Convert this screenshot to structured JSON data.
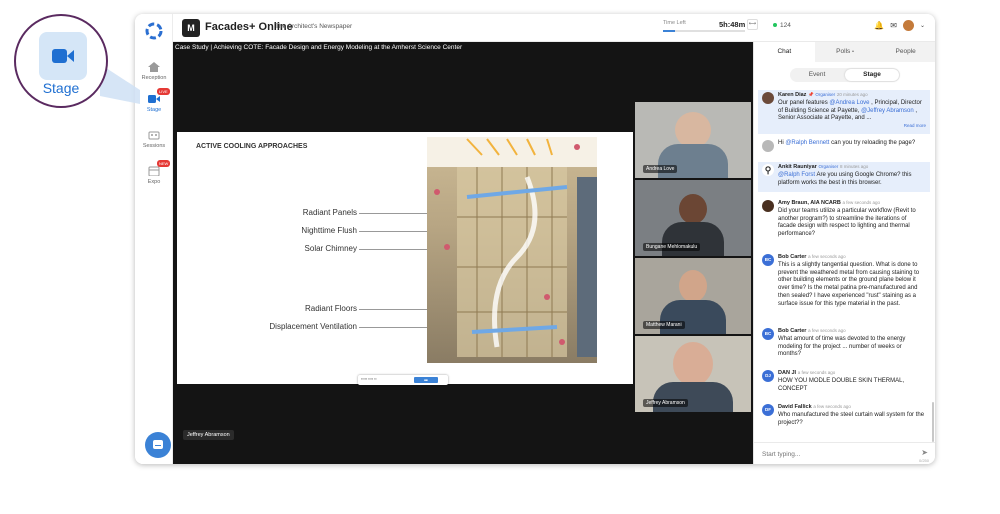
{
  "callout": {
    "label": "Stage"
  },
  "rail": {
    "items": [
      {
        "label": "Reception"
      },
      {
        "label": "Stage",
        "badge": "LIVE"
      },
      {
        "label": "Sessions"
      },
      {
        "label": "Expo",
        "badge": "NEW"
      }
    ]
  },
  "topbar": {
    "brand": "Facades+ Online",
    "brand_sub": "The Architect's Newspaper",
    "time_left_label": "Time Left",
    "time_left_value": "5h:48m",
    "time_left_progress": 0.15,
    "viewers": "124"
  },
  "video": {
    "title": "Case Study | Achieving COTE: Facade Design and Energy Modeling at the Amherst Science Center",
    "presenter": "Jeffrey Abramson",
    "slide": {
      "title": "ACTIVE COOLING APPROACHES",
      "labels": [
        "Radiant Panels",
        "Nighttime Flush",
        "Solar Chimney",
        "Radiant Floors",
        "Displacement Ventilation"
      ]
    },
    "participants": [
      {
        "name": "Andrea Love"
      },
      {
        "name": "Bungane Mehlomakulu"
      },
      {
        "name": "Matthew Marani"
      },
      {
        "name": "Jeffrey Abramson"
      }
    ]
  },
  "panel": {
    "tabs": [
      "Chat",
      "Polls",
      "People"
    ],
    "segments": [
      "Event",
      "Stage"
    ],
    "composer_placeholder": "Start typing...",
    "char_count": "0/250",
    "messages": [
      {
        "name": "Karen Diaz",
        "role": "Organiser",
        "time": "20 minutes ago",
        "parts": [
          "Our panel features ",
          "@Andrea Love",
          " , Principal, Director of Building Science at Payette, ",
          "@Jeffrey Abramson",
          " , Senior Associate at Payette, and ..."
        ],
        "more": "Read more"
      },
      {
        "text_parts": [
          "Hi ",
          "@Ralph Bennett",
          " can you try reloading the page?"
        ]
      },
      {
        "name": "Ankit Rauniyar",
        "role": "Organiser",
        "time": "8 minutes ago",
        "parts": [
          "@Ralph Forst",
          " Are you using Google Chrome? this platform works the best in this browser."
        ]
      },
      {
        "name": "Amy Braun, AIA NCARB",
        "time": "a few seconds ago",
        "text": "Did your teams utilize a particular workflow (Revit to another program?) to streamline the iterations of facade design with respect to lighting and thermal performance?"
      },
      {
        "initials": "BC",
        "name": "Bob Carter",
        "time": "a few seconds ago",
        "text": "This is a slightly tangential question. What is done to prevent the weathered metal from causing staining to other building elements or the ground plane below it over time? Is the metal patina pre-manufactured and then sealed? I have experienced \"rust\" staining as a surface issue for this type material in the past."
      },
      {
        "initials": "BC",
        "name": "Bob Carter",
        "time": "a few seconds ago",
        "text": "What amount of time was devoted to the energy modeling for the project ... number of weeks or months?"
      },
      {
        "initials": "DJ",
        "name": "DAN JI",
        "time": "a few seconds ago",
        "text": "HOW YOU MODLE DOUBLE SKIN THERMAL, CONCEPT"
      },
      {
        "initials": "DF",
        "name": "David Fallick",
        "time": "a few seconds ago",
        "text": "Who manufactured the steel curtain wall system for the project??"
      }
    ]
  }
}
